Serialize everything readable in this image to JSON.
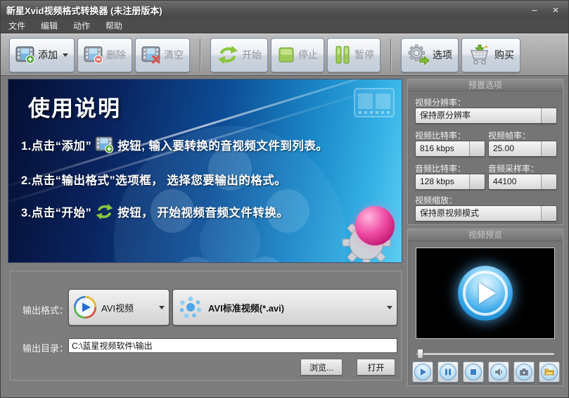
{
  "window": {
    "title": "新星Xvid视频格式转换器 (未注册版本)",
    "controls": {
      "minimize": "–",
      "close": "×"
    }
  },
  "menu": {
    "items": [
      {
        "label": "文件"
      },
      {
        "label": "编辑"
      },
      {
        "label": "动作"
      },
      {
        "label": "帮助"
      }
    ]
  },
  "toolbar": {
    "add": "添加",
    "delete": "删除",
    "clear": "清空",
    "start": "开始",
    "stop": "停止",
    "pause": "暂停",
    "options": "选项",
    "buy": "购买"
  },
  "banner": {
    "title": "使用说明",
    "step1_pre": "1.点击“添加”",
    "step1_post": "按钮, 输入要转换的音视频文件到列表。",
    "step2": "2.点击“输出格式”选项框， 选择您要输出的格式。",
    "step3_pre": "3.点击“开始”",
    "step3_post": "按钮， 开始视频音频文件转换。"
  },
  "presets": {
    "group_title": "预置选项",
    "resolution_label": "视频分辨率：",
    "resolution_value": "保持原分辨率",
    "video_bitrate_label": "视频比特率：",
    "video_bitrate_value": "816 kbps",
    "framerate_label": "视频帧率：",
    "framerate_value": "25.00",
    "audio_bitrate_label": "音频比特率：",
    "audio_bitrate_value": "128 kbps",
    "samplerate_label": "音频采样率：",
    "samplerate_value": "44100",
    "scale_label": "视频缩放：",
    "scale_value": "保持原视频模式"
  },
  "preview": {
    "group_title": "视频预览"
  },
  "output": {
    "format_label": "输出格式：",
    "format_category": "AVI视频",
    "format_profile": "AVI标准视频(*.avi)",
    "dir_label": "输出目录：",
    "dir_value": "C:\\蓝星视频软件\\输出",
    "browse": "浏览...",
    "open": "打开"
  }
}
